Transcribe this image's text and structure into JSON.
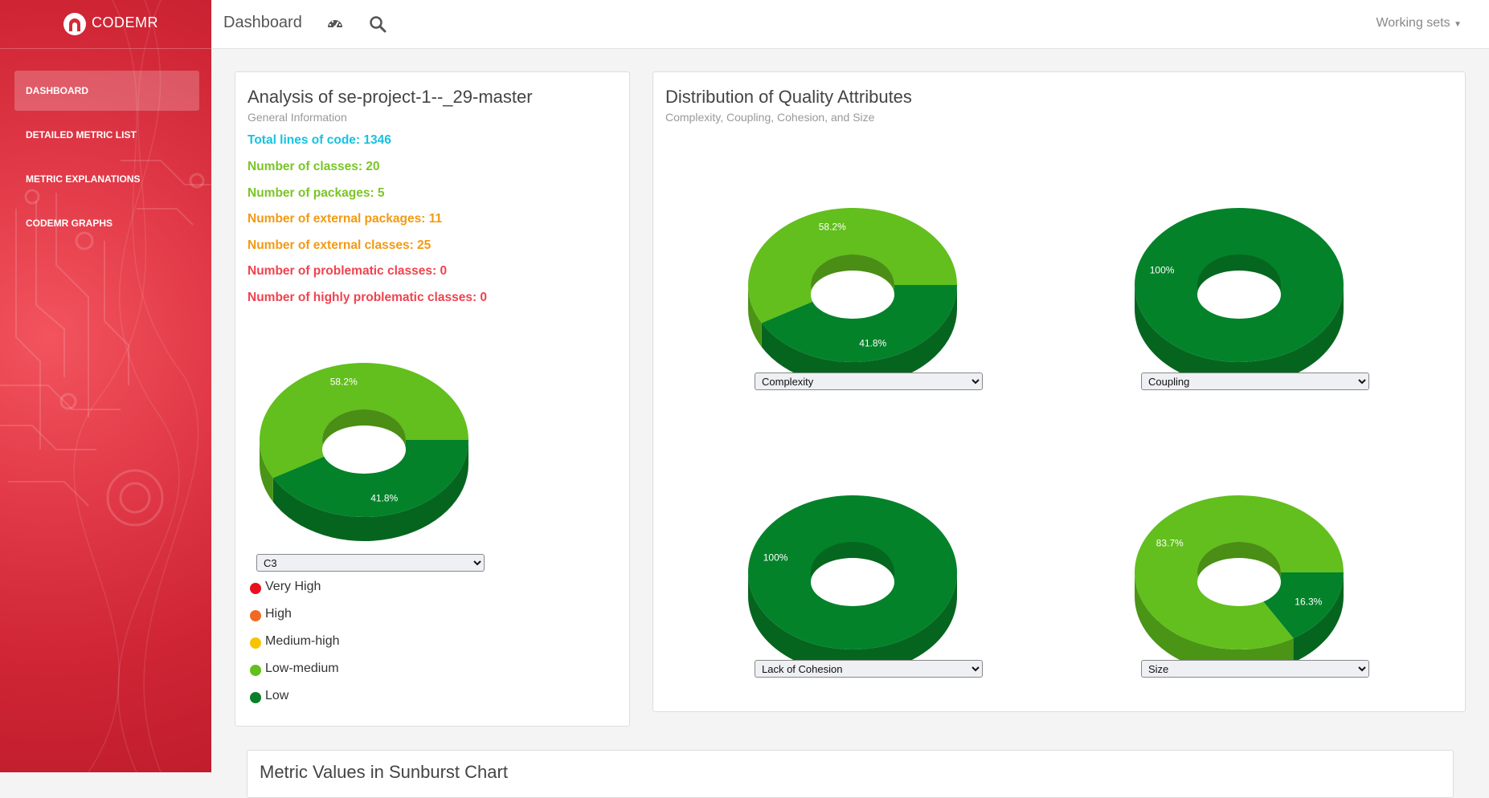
{
  "brand": {
    "name": "CODEMR"
  },
  "sidebar": {
    "items": [
      {
        "label": "DASHBOARD",
        "active": true
      },
      {
        "label": "DETAILED METRIC LIST",
        "active": false
      },
      {
        "label": "METRIC EXPLANATIONS",
        "active": false
      },
      {
        "label": "CODEMR GRAPHS",
        "active": false
      }
    ]
  },
  "topbar": {
    "title": "Dashboard",
    "icons": [
      "gauge-icon",
      "search-icon"
    ],
    "working_sets": "Working sets"
  },
  "analysis": {
    "title": "Analysis of se-project-1--_29-master",
    "subtitle": "General Information",
    "stats": [
      {
        "text": "Total lines of code: 1346",
        "color": "#17c2e0"
      },
      {
        "text": "Number of classes: 20",
        "color": "#7ac526"
      },
      {
        "text": "Number of packages: 5",
        "color": "#7ac526"
      },
      {
        "text": "Number of external packages: 11",
        "color": "#f39a12"
      },
      {
        "text": "Number of external classes: 25",
        "color": "#f39a12"
      },
      {
        "text": "Number of problematic classes: 0",
        "color": "#f0434f"
      },
      {
        "text": "Number of highly problematic classes: 0",
        "color": "#f0434f"
      }
    ],
    "selector_value": "C3",
    "legend": [
      {
        "label": "Very High",
        "color": "#e8101c"
      },
      {
        "label": "High",
        "color": "#f26a22"
      },
      {
        "label": "Medium-high",
        "color": "#f7c400"
      },
      {
        "label": "Low-medium",
        "color": "#62bf1d"
      },
      {
        "label": "Low",
        "color": "#0b7e2a"
      }
    ]
  },
  "distribution": {
    "title": "Distribution of Quality Attributes",
    "subtitle": "Complexity, Coupling, Cohesion, and Size",
    "selectors": [
      "Complexity",
      "Coupling",
      "Lack of Cohesion",
      "Size"
    ]
  },
  "sunburst": {
    "title": "Metric Values in Sunburst Chart"
  },
  "colors": {
    "low_medium": "#62bf1d",
    "low": "#03822a",
    "accent": "#d9293a"
  },
  "chart_data": [
    {
      "type": "pie",
      "id": "c3",
      "categories": [
        "Low-medium",
        "Low"
      ],
      "values": [
        58.2,
        41.8
      ],
      "labels": [
        "58.2%",
        "41.8%"
      ]
    },
    {
      "type": "pie",
      "id": "complexity",
      "categories": [
        "Low-medium",
        "Low"
      ],
      "values": [
        58.2,
        41.8
      ],
      "labels": [
        "58.2%",
        "41.8%"
      ]
    },
    {
      "type": "pie",
      "id": "coupling",
      "categories": [
        "Low"
      ],
      "values": [
        100
      ],
      "labels": [
        "100%"
      ]
    },
    {
      "type": "pie",
      "id": "lack_of_cohesion",
      "categories": [
        "Low"
      ],
      "values": [
        100
      ],
      "labels": [
        "100%"
      ]
    },
    {
      "type": "pie",
      "id": "size",
      "categories": [
        "Low-medium",
        "Low"
      ],
      "values": [
        83.7,
        16.3
      ],
      "labels": [
        "83.7%",
        "16.3%"
      ]
    }
  ]
}
